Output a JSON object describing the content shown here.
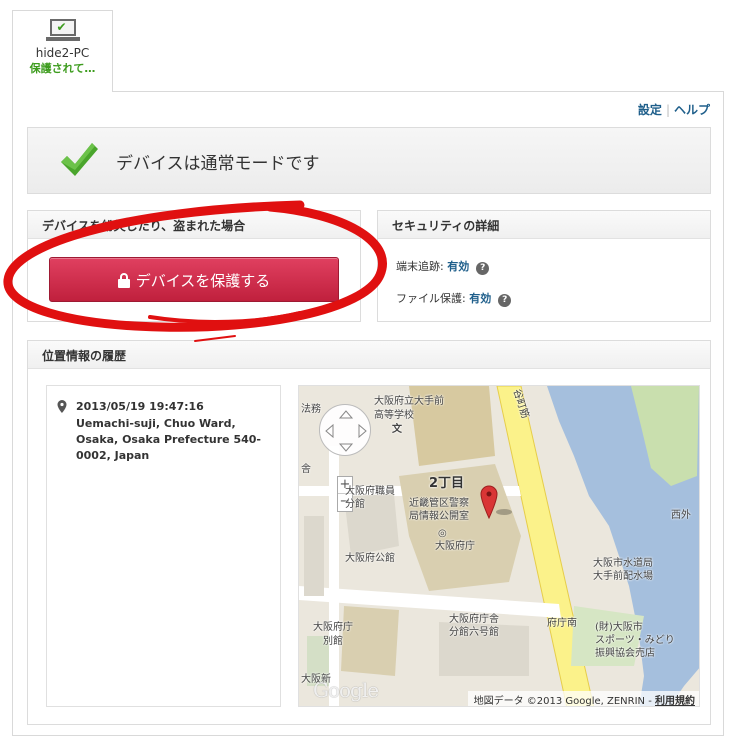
{
  "device": {
    "name": "hide2-PC",
    "status": "保護されて…",
    "icon": "laptop-check-icon"
  },
  "links": {
    "settings": "設定",
    "help": "ヘルプ"
  },
  "banner": {
    "text": "デバイスは通常モードです",
    "icon": "checkmark-icon",
    "color": "#4aa52c"
  },
  "lost_panel": {
    "heading": "デバイスを紛失したり、盗まれた場合",
    "button_label": "デバイスを保護する",
    "button_icon": "lock-icon",
    "button_color": "#d0304f"
  },
  "security_panel": {
    "heading": "セキュリティの詳細",
    "rows": [
      {
        "label": "端末追跡:",
        "value": "有効"
      },
      {
        "label": "ファイル保護:",
        "value": "有効"
      }
    ]
  },
  "location_panel": {
    "heading": "位置情報の履歴",
    "entry": {
      "date": "2013/05/19 19:47:16",
      "address": "Uemachi-suji, Chuo Ward, Osaka, Osaka Prefecture 540-0002, Japan"
    },
    "map": {
      "labels": {
        "osaka_otemae": "大阪府立大手前",
        "otemae_high": "高等学校",
        "bun": "文",
        "houmu": "法務",
        "tsuji": "谷町筋",
        "pref_staff": "大阪府職員",
        "branch": "分館",
        "block": "2丁目",
        "police1": "近畿管区警察",
        "police2": "局情報公開室",
        "pref_office": "大阪府庁",
        "pref_hall": "大阪府公館",
        "water1": "大阪市水道局",
        "water2": "大手前配水場",
        "west": "西外",
        "annex1": "大阪府庁",
        "annex2": "別館",
        "six1": "大阪府庁舎",
        "six2": "分館六号館",
        "fuchominami": "府庁南",
        "sports1": "(財)大阪市",
        "sports2": "スポーツ・みどり",
        "sports3": "振興協会売店",
        "shin": "大阪新",
        "cho": "舎"
      },
      "attribution": "地図データ ©2013 Google, ZENRIN - ",
      "terms": "利用規約",
      "logo": "Google",
      "pin_color": "#d93535"
    }
  }
}
